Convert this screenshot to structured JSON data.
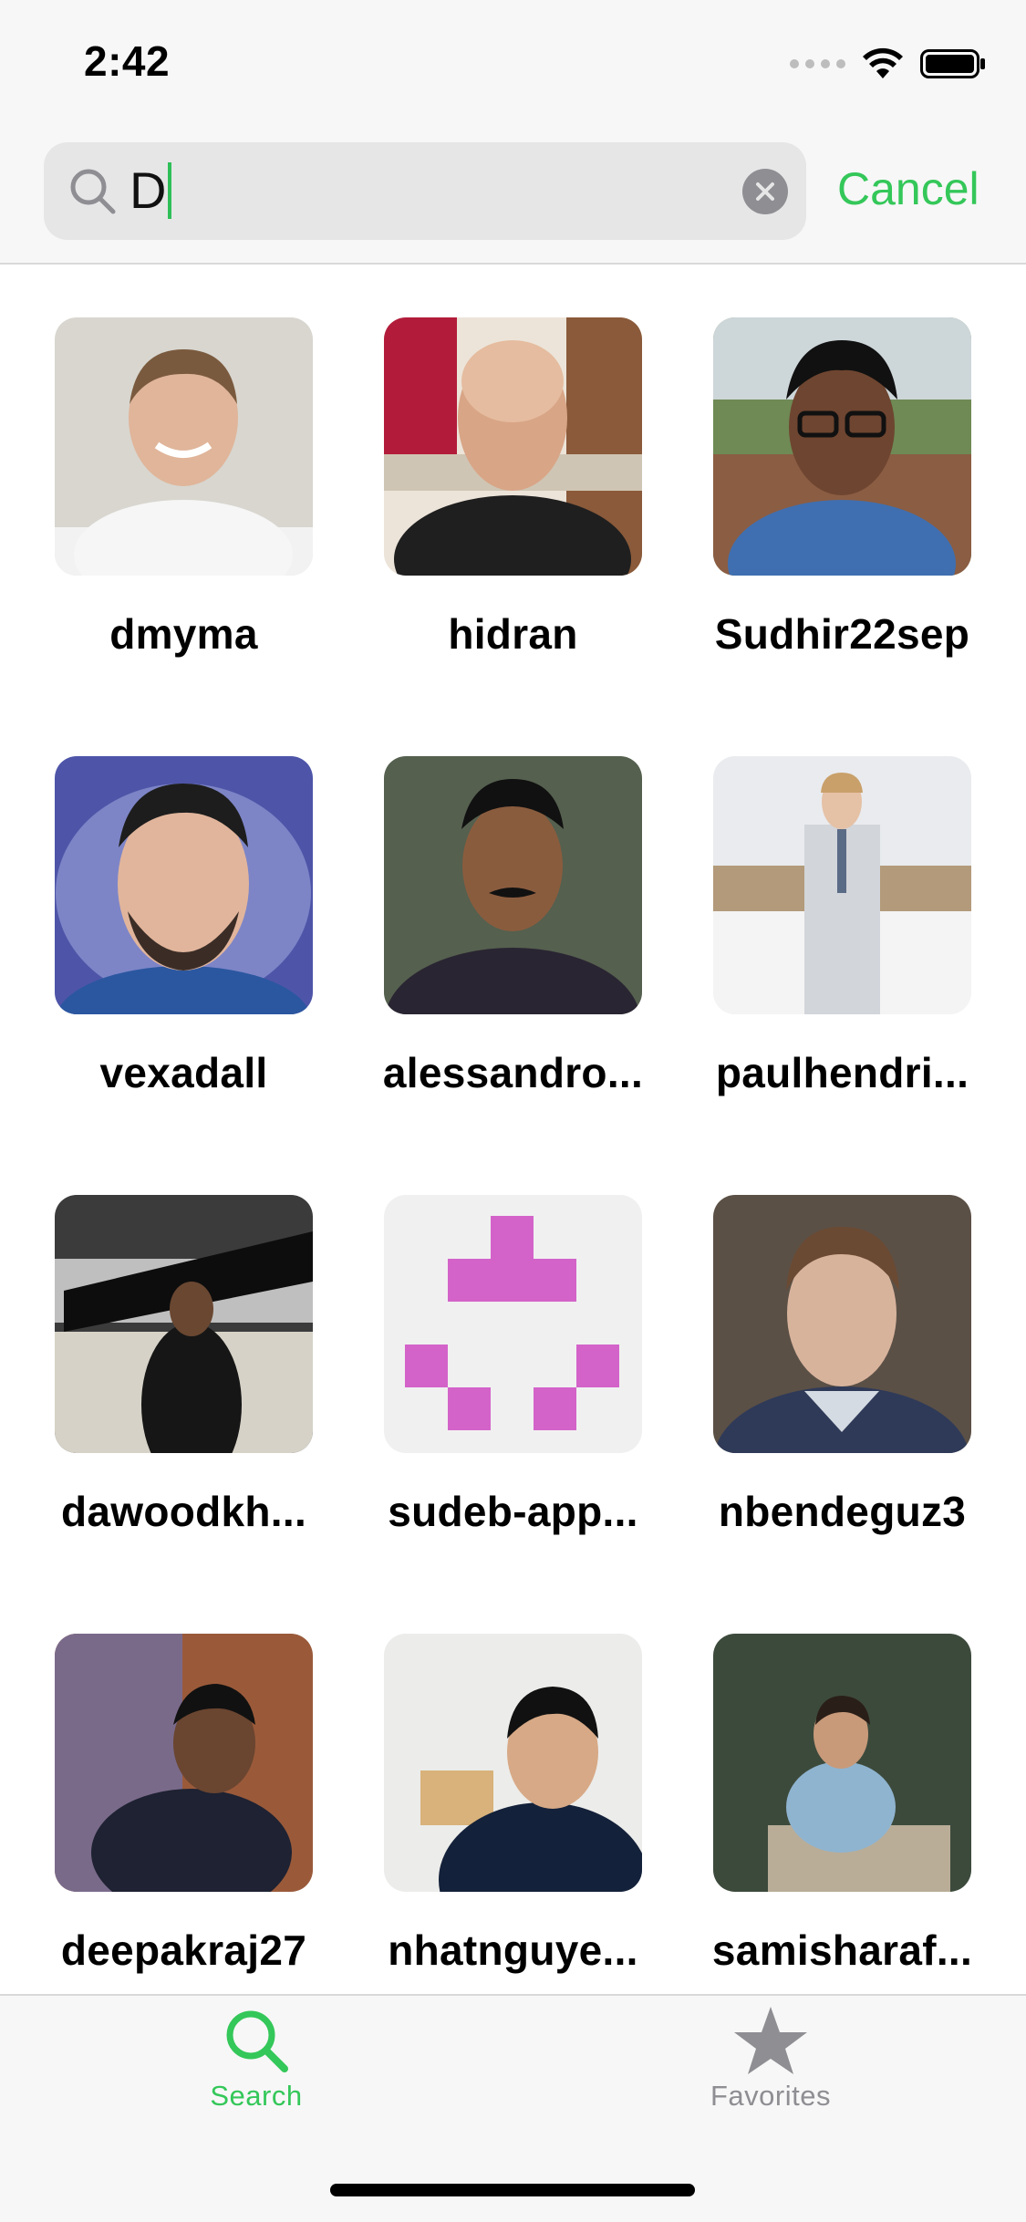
{
  "status_bar": {
    "time": "2:42"
  },
  "search": {
    "value": "D",
    "cancel_label": "Cancel"
  },
  "results": [
    {
      "username": "dmyma",
      "avatar": "person-photo"
    },
    {
      "username": "hidran",
      "avatar": "person-photo"
    },
    {
      "username": "Sudhir22sep",
      "avatar": "person-photo"
    },
    {
      "username": "vexadall",
      "avatar": "person-photo"
    },
    {
      "username": "alessandro...",
      "avatar": "person-photo"
    },
    {
      "username": "paulhendri...",
      "avatar": "person-photo"
    },
    {
      "username": "dawoodkh...",
      "avatar": "person-photo"
    },
    {
      "username": "sudeb-app...",
      "avatar": "identicon"
    },
    {
      "username": "nbendeguz3",
      "avatar": "person-photo"
    },
    {
      "username": "deepakraj27",
      "avatar": "person-photo"
    },
    {
      "username": "nhatnguye...",
      "avatar": "person-photo"
    },
    {
      "username": "samisharaf...",
      "avatar": "person-photo"
    }
  ],
  "tabs": [
    {
      "label": "Search",
      "icon": "search-icon",
      "active": true
    },
    {
      "label": "Favorites",
      "icon": "star-icon",
      "active": false
    }
  ],
  "colors": {
    "accent": "#34c759",
    "inactive": "#8e8e93",
    "identicon": "#d363c9"
  }
}
